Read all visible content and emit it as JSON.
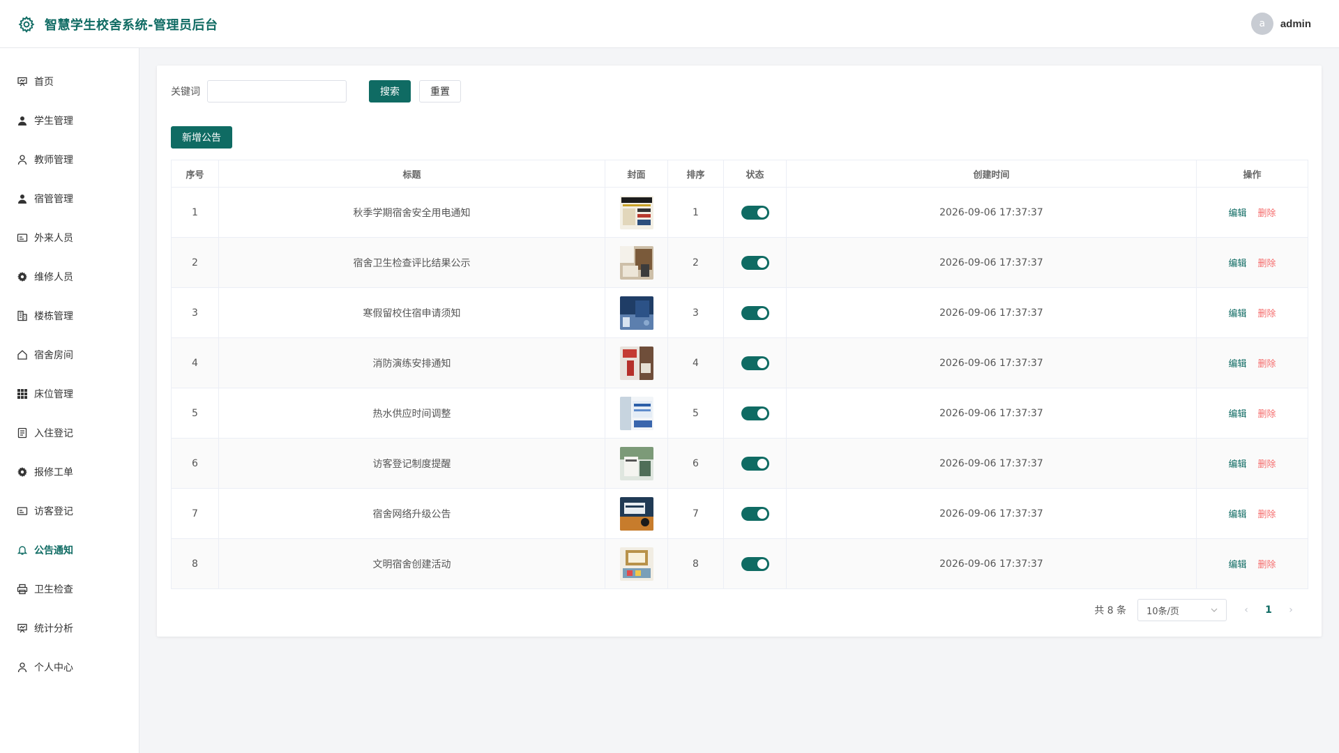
{
  "header": {
    "title": "智慧学生校舍系统-管理员后台",
    "avatar_letter": "a",
    "username": "admin"
  },
  "sidebar": {
    "items": [
      {
        "label": "首页",
        "icon": "presentation-icon"
      },
      {
        "label": "学生管理",
        "icon": "user-filled-icon"
      },
      {
        "label": "教师管理",
        "icon": "user-icon"
      },
      {
        "label": "宿管管理",
        "icon": "user-filled-icon"
      },
      {
        "label": "外来人员",
        "icon": "id-card-icon"
      },
      {
        "label": "维修人员",
        "icon": "gear-icon"
      },
      {
        "label": "楼栋管理",
        "icon": "building-icon"
      },
      {
        "label": "宿舍房间",
        "icon": "house-icon"
      },
      {
        "label": "床位管理",
        "icon": "grid-icon"
      },
      {
        "label": "入住登记",
        "icon": "document-icon"
      },
      {
        "label": "报修工单",
        "icon": "gear-icon"
      },
      {
        "label": "访客登记",
        "icon": "id-card-icon"
      },
      {
        "label": "公告通知",
        "icon": "bell-icon",
        "active": true
      },
      {
        "label": "卫生检查",
        "icon": "printer-icon"
      },
      {
        "label": "统计分析",
        "icon": "presentation-icon"
      },
      {
        "label": "个人中心",
        "icon": "user-icon"
      }
    ],
    "active_color": "#0f6b63"
  },
  "search": {
    "label": "关键词",
    "placeholder": "",
    "value": "",
    "search_btn": "搜索",
    "reset_btn": "重置"
  },
  "add_btn": "新增公告",
  "table": {
    "headers": [
      "序号",
      "标题",
      "封面",
      "排序",
      "状态",
      "创建时间",
      "操作"
    ],
    "rows": [
      {
        "idx": "1",
        "title": "秋季学期宿舍安全用电通知",
        "sort": "1",
        "status": true,
        "created": "2026-09-06 17:37:37",
        "edit": "编辑",
        "del": "删除"
      },
      {
        "idx": "2",
        "title": "宿舍卫生检查评比结果公示",
        "sort": "2",
        "status": true,
        "created": "2026-09-06 17:37:37",
        "edit": "编辑",
        "del": "删除"
      },
      {
        "idx": "3",
        "title": "寒假留校住宿申请须知",
        "sort": "3",
        "status": true,
        "created": "2026-09-06 17:37:37",
        "edit": "编辑",
        "del": "删除"
      },
      {
        "idx": "4",
        "title": "消防演练安排通知",
        "sort": "4",
        "status": true,
        "created": "2026-09-06 17:37:37",
        "edit": "编辑",
        "del": "删除"
      },
      {
        "idx": "5",
        "title": "热水供应时间调整",
        "sort": "5",
        "status": true,
        "created": "2026-09-06 17:37:37",
        "edit": "编辑",
        "del": "删除"
      },
      {
        "idx": "6",
        "title": "访客登记制度提醒",
        "sort": "6",
        "status": true,
        "created": "2026-09-06 17:37:37",
        "edit": "编辑",
        "del": "删除"
      },
      {
        "idx": "7",
        "title": "宿舍网络升级公告",
        "sort": "7",
        "status": true,
        "created": "2026-09-06 17:37:37",
        "edit": "编辑",
        "del": "删除"
      },
      {
        "idx": "8",
        "title": "文明宿舍创建活动",
        "sort": "8",
        "status": true,
        "created": "2026-09-06 17:37:37",
        "edit": "编辑",
        "del": "删除"
      }
    ]
  },
  "pagination": {
    "total": "共 8 条",
    "page_size": "10条/页",
    "current": "1"
  },
  "colors": {
    "primary": "#0f6b63",
    "danger": "#f56c6c"
  }
}
